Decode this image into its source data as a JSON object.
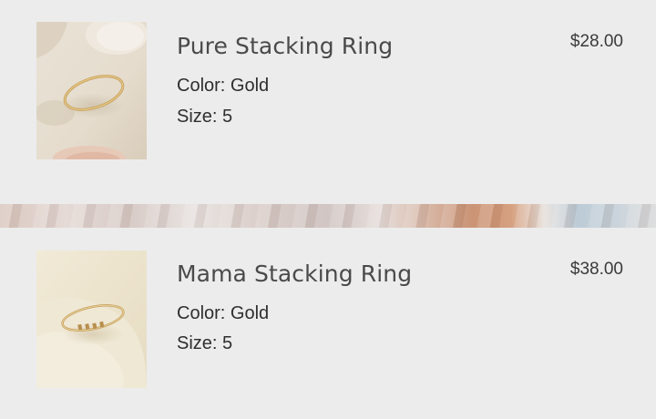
{
  "cart": {
    "items": [
      {
        "name": "Pure Stacking Ring",
        "color": "Color: Gold",
        "size": "Size: 5",
        "price": "$28.00",
        "image_icon": "gold-ring-photo"
      },
      {
        "name": "Mama Stacking Ring",
        "color": "Color: Gold",
        "size": "Size: 5",
        "price": "$38.00",
        "image_icon": "engraved-gold-ring-photo"
      }
    ]
  },
  "colors": {
    "background": "#ececec",
    "title_text": "#4a4a4a",
    "body_text": "#2e2e2e"
  }
}
